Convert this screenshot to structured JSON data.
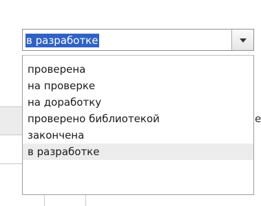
{
  "combo": {
    "selected_value": "в разработке",
    "dropdown_icon": "chevron-down-icon"
  },
  "options": [
    "проверена",
    "на проверке",
    "на доработку",
    "проверено библиотекой",
    "закончена",
    "в разработке"
  ],
  "selected_index": 5,
  "background": {
    "partial_char": "е"
  },
  "colors": {
    "selection_highlight": "#3062c4",
    "selected_row": "#ececec",
    "border": "#8e8e8e"
  }
}
